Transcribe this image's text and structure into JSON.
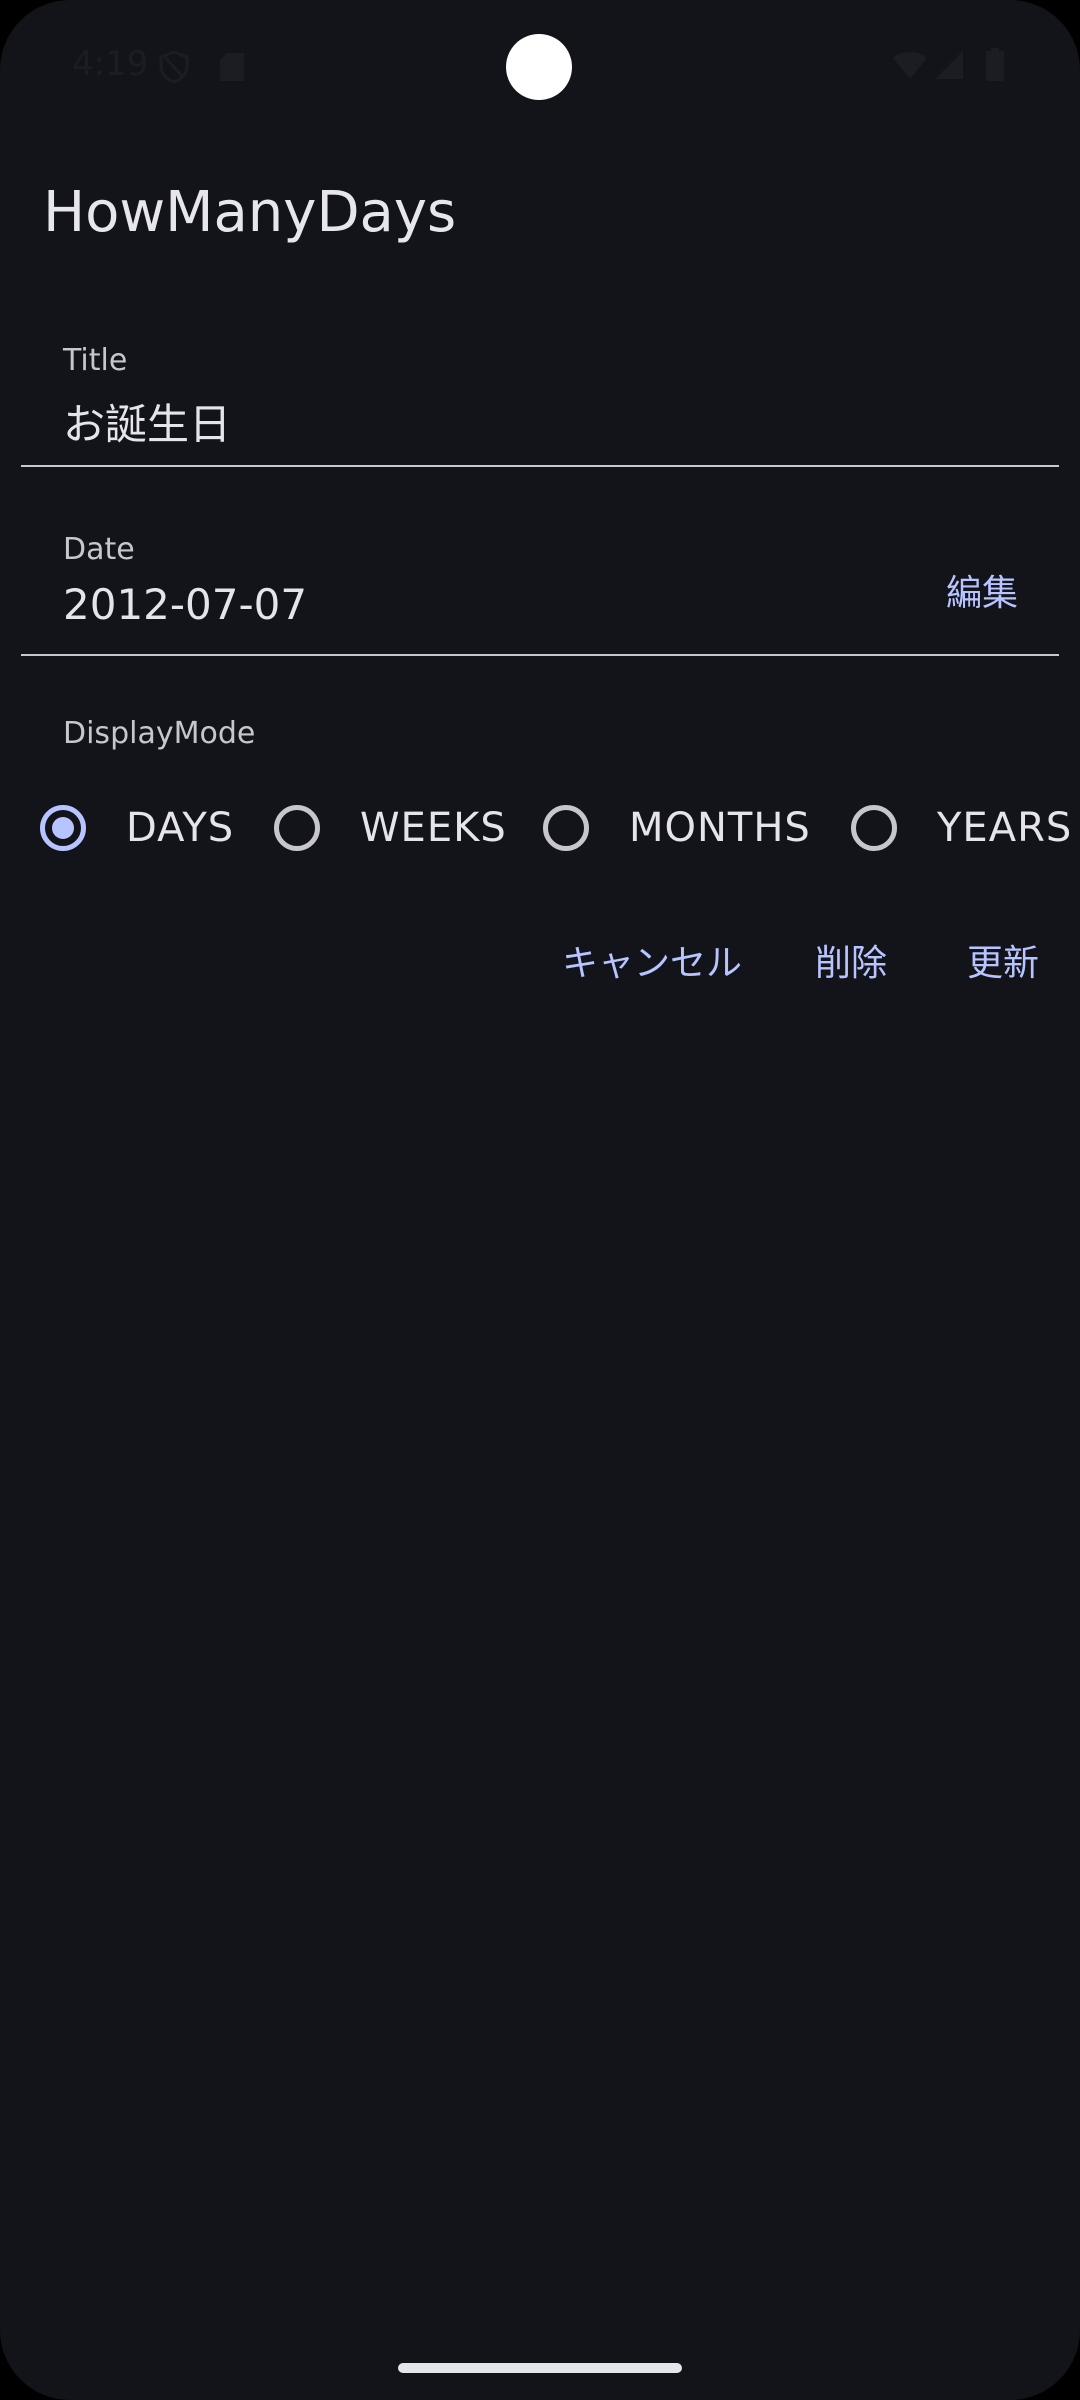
{
  "status_bar": {
    "time": "4:19",
    "icons": [
      "shield-icon",
      "sd-card-icon",
      "wifi-icon",
      "signal-icon",
      "battery-icon"
    ]
  },
  "app": {
    "title": "HowManyDays"
  },
  "form": {
    "title_field": {
      "label": "Title",
      "value": "お誕生日"
    },
    "date_field": {
      "label": "Date",
      "value": "2012-07-07",
      "edit_button": "編集"
    },
    "display_mode": {
      "label": "DisplayMode",
      "options": [
        {
          "label": "DAYS",
          "selected": true
        },
        {
          "label": "WEEKS",
          "selected": false
        },
        {
          "label": "MONTHS",
          "selected": false
        },
        {
          "label": "YEARS",
          "selected": false
        }
      ]
    }
  },
  "actions": {
    "cancel": "キャンセル",
    "delete": "削除",
    "update": "更新"
  },
  "colors": {
    "background": "#13141a",
    "accent": "#b8c4ff",
    "text_primary": "#e4e4ea",
    "text_secondary": "#c6c6cf",
    "divider": "#c7c6cc"
  }
}
